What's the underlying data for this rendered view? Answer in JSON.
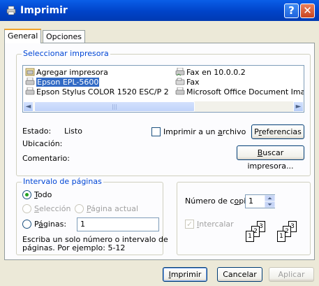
{
  "window": {
    "title": "Imprimir",
    "help_glyph": "?",
    "close_glyph": "✕"
  },
  "tabs": [
    {
      "label": "General"
    },
    {
      "label": "Opciones"
    }
  ],
  "printer_section": {
    "label": "Seleccionar impresora",
    "printers": [
      {
        "name": "Agregar impresora",
        "icon": "add-printer-icon"
      },
      {
        "name": "Fax en 10.0.0.2",
        "icon": "printer-icon"
      },
      {
        "name": "Epson EPL-5600",
        "icon": "printer-icon",
        "selected": true
      },
      {
        "name": "Fax",
        "icon": "fax-icon"
      },
      {
        "name": "Epson Stylus COLOR 1520 ESC/P 2",
        "icon": "printer-icon"
      },
      {
        "name": "Microsoft Office Document Image W",
        "icon": "printer-icon"
      }
    ],
    "status_label": "Estado:",
    "status_value": "Listo",
    "location_label": "Ubicación:",
    "location_value": "",
    "comment_label": "Comentario:",
    "comment_value": "",
    "print_to_file_pre": "Imprimir a un ",
    "print_to_file_u": "a",
    "print_to_file_post": "rchivo",
    "preferences_pre": "P",
    "preferences_u": "r",
    "preferences_post": "eferencias",
    "find_printer_u": "B",
    "find_printer_post": "uscar impresora..."
  },
  "page_range": {
    "label": "Intervalo de páginas",
    "all_u": "T",
    "all_post": "odo",
    "selection_u": "S",
    "selection_post": "elección",
    "current_u": "P",
    "current_post": "ágina actual",
    "pages_pre": "P",
    "pages_u": "á",
    "pages_post": "ginas:",
    "pages_value": "1",
    "hint": [
      "Escriba un solo número o intervalo de",
      "páginas. Por ejemplo: 5-12"
    ],
    "selected_option": "all"
  },
  "copies": {
    "label_pre": "Número de c",
    "label_u": "o",
    "label_post": "pias:",
    "value": "1",
    "collate_u": "I",
    "collate_post": "ntercalar",
    "collate_checked": true,
    "collate_pages": [
      "1",
      "2",
      "3",
      "1",
      "2",
      "3"
    ]
  },
  "footer": {
    "print_u": "I",
    "print_post": "mprimir",
    "cancel": "Cancelar",
    "apply": "Aplicar"
  },
  "colors": {
    "titlebar": "#0054e3",
    "selection": "#316ac5",
    "group_label": "#0046d5",
    "radio_dot": "#21a121"
  }
}
